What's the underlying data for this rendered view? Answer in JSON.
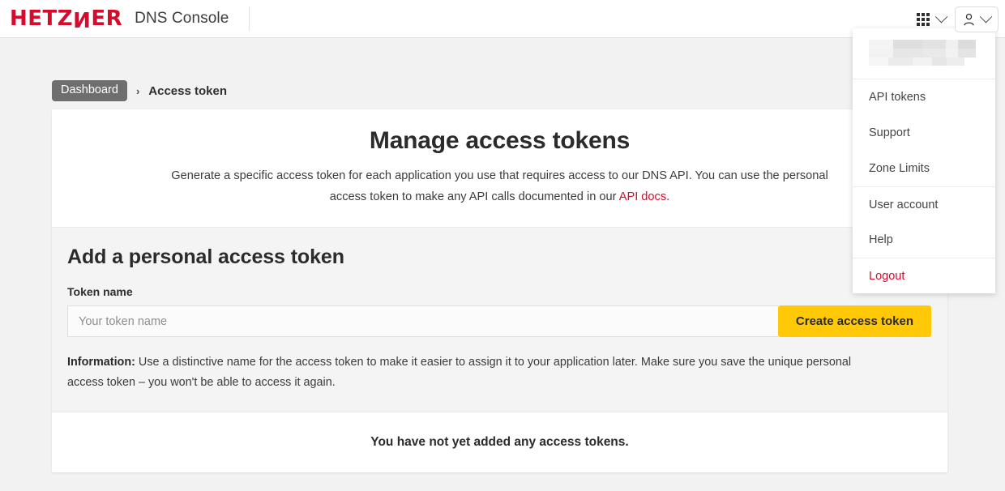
{
  "header": {
    "logo_text_a": "HETZ",
    "logo_text_n": "N",
    "logo_text_b": "ER",
    "app_title": "DNS Console",
    "grid_icon": "apps-grid-icon",
    "grid_chevron": "chevron-down-icon",
    "user_icon": "person-icon",
    "user_chevron": "chevron-down-icon"
  },
  "user_menu": {
    "account_name_redacted": "",
    "items": [
      {
        "label": "API tokens",
        "separator_before": false,
        "danger": false
      },
      {
        "label": "Support",
        "separator_before": false,
        "danger": false
      },
      {
        "label": "Zone Limits",
        "separator_before": false,
        "danger": false
      },
      {
        "label": "User account",
        "separator_before": true,
        "danger": false
      },
      {
        "label": "Help",
        "separator_before": false,
        "danger": false
      },
      {
        "label": "Logout",
        "separator_before": true,
        "danger": true
      }
    ]
  },
  "breadcrumb": {
    "root": "Dashboard",
    "separator": "›",
    "current": "Access token"
  },
  "card": {
    "title": "Manage access tokens",
    "description_part1": "Generate a specific access token for each application you use that requires access to our DNS API. You can use the personal access token to make any API calls documented in our ",
    "description_link": "API docs",
    "description_part2": ".",
    "section_title": "Add a personal access token",
    "field_label": "Token name",
    "input_placeholder": "Your token name",
    "input_value": "",
    "submit_label": "Create access token",
    "info_label": "Information:",
    "info_text": " Use a distinctive name for the access token to make it easier to assign it to your application later. Make sure you save the unique personal access token – you won't be able to access it again.",
    "empty_state": "You have not yet added any access tokens."
  },
  "colors": {
    "brand_red": "#d50c2d",
    "accent_yellow": "#ffc907",
    "page_bg": "#f2f2f2",
    "section_bg": "#f4f4f4",
    "crumb_pill": "#6e6e6e"
  }
}
